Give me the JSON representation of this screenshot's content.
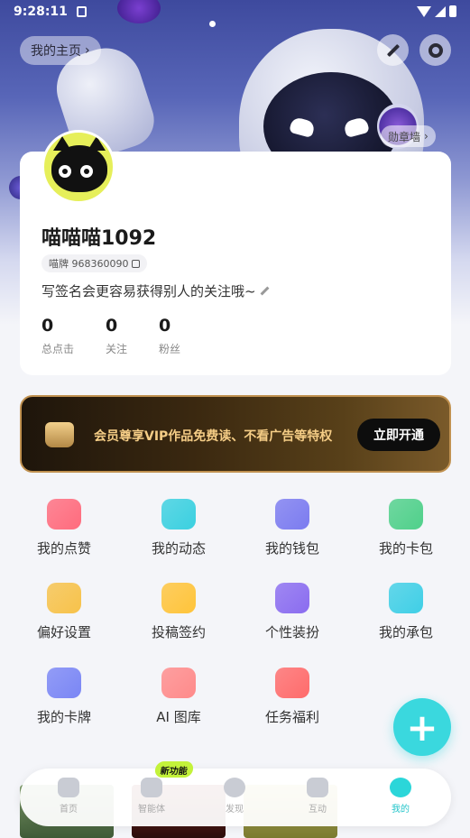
{
  "status_bar": {
    "time": "9:28:11"
  },
  "header": {
    "homepage_label": "我的主页",
    "badge_wall_label": "勋章墙"
  },
  "profile": {
    "username": "喵喵喵1092",
    "id_label": "喵牌 968360090",
    "signature": "写签名会更容易获得别人的关注哦~",
    "stats": [
      {
        "value": "0",
        "label": "总点击"
      },
      {
        "value": "0",
        "label": "关注"
      },
      {
        "value": "0",
        "label": "粉丝"
      }
    ]
  },
  "vip": {
    "text": "会员尊享VIP作品免费读、不看广告等特权",
    "button": "立即开通"
  },
  "grid": [
    {
      "label": "我的点赞",
      "icon": "heart-icon",
      "color": "#ff6b7d"
    },
    {
      "label": "我的动态",
      "icon": "leaf-icon",
      "color": "#3ad0e0"
    },
    {
      "label": "我的钱包",
      "icon": "wallet-icon",
      "color": "#7b7bf0"
    },
    {
      "label": "我的卡包",
      "icon": "card-icon",
      "color": "#4fd08a"
    },
    {
      "label": "偏好设置",
      "icon": "heart-badge-icon",
      "color": "#f7c24a"
    },
    {
      "label": "投稿签约",
      "icon": "lightbulb-icon",
      "color": "#ffc43a"
    },
    {
      "label": "个性装扮",
      "icon": "outfit-icon",
      "color": "#8a6cf0"
    },
    {
      "label": "我的承包",
      "icon": "whale-icon",
      "color": "#3fcfe6"
    },
    {
      "label": "我的卡牌",
      "icon": "cards-icon",
      "color": "#7a86f5"
    },
    {
      "label": "AI 图库",
      "icon": "image-gallery-icon",
      "color": "#ff8a8a"
    },
    {
      "label": "任务福利",
      "icon": "gift-bag-icon",
      "color": "#ff6b6b"
    }
  ],
  "tab_bar": {
    "new_badge": "新功能",
    "tabs": [
      {
        "label": "首页",
        "icon": "home-icon"
      },
      {
        "label": "智能体",
        "icon": "ai-icon"
      },
      {
        "label": "发现",
        "icon": "discover-icon"
      },
      {
        "label": "互动",
        "icon": "chat-icon"
      },
      {
        "label": "我的",
        "icon": "profile-icon"
      }
    ],
    "active_tab": "我的"
  },
  "fab": {
    "symbol": "+"
  }
}
